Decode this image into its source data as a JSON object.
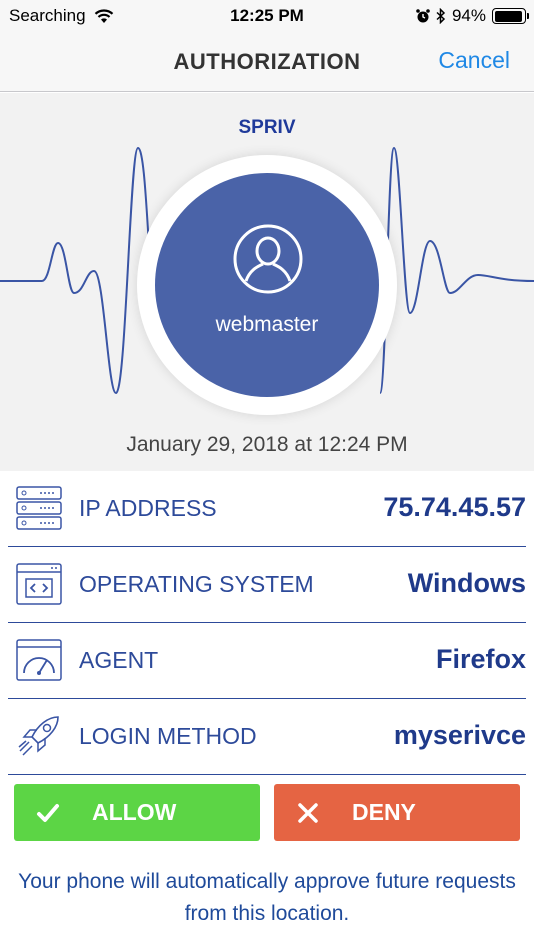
{
  "status_bar": {
    "carrier": "Searching",
    "time": "12:25 PM",
    "battery": "94%",
    "battery_level": 0.94,
    "icons": [
      "wifi-icon",
      "alarm-icon",
      "bluetooth-icon",
      "battery-icon"
    ]
  },
  "nav": {
    "title": "AUTHORIZATION",
    "cancel_label": "Cancel"
  },
  "hero": {
    "brand": "SPRIV",
    "username": "webmaster",
    "timestamp": "January 29, 2018 at 12:24 PM"
  },
  "details": [
    {
      "icon": "server-icon",
      "label": "IP ADDRESS",
      "value": "75.74.45.57"
    },
    {
      "icon": "code-window-icon",
      "label": "OPERATING SYSTEM",
      "value": "Windows"
    },
    {
      "icon": "speedometer-icon",
      "label": "AGENT",
      "value": "Firefox"
    },
    {
      "icon": "rocket-icon",
      "label": "LOGIN METHOD",
      "value": "myserivce"
    }
  ],
  "actions": {
    "allow_label": "ALLOW",
    "deny_label": "DENY"
  },
  "note": "Your phone will automatically approve future requests from this location.",
  "colors": {
    "accent_blue": "#1f3a8a",
    "link_blue": "#1f88e5",
    "avatar_bg": "#4a63a8",
    "allow_green": "#5cd545",
    "deny_red": "#e56443"
  }
}
